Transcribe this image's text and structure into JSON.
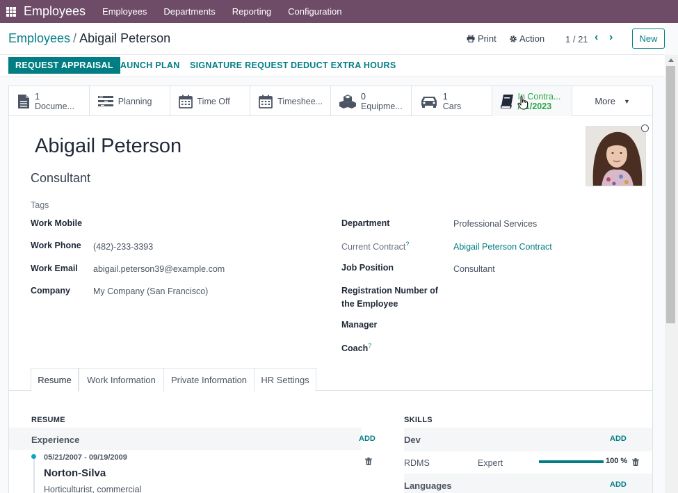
{
  "nav": {
    "app_title": "Employees",
    "items": [
      "Employees",
      "Departments",
      "Reporting",
      "Configuration"
    ]
  },
  "control": {
    "breadcrumb_parent": "Employees",
    "breadcrumb_separator": "/",
    "breadcrumb_current": "Abigail Peterson",
    "print": "Print",
    "action": "Action",
    "pager": "1 / 21",
    "new": "New"
  },
  "statusbar": {
    "buttons": [
      "REQUEST APPRAISAL",
      "LAUNCH PLAN",
      "SIGNATURE REQUEST",
      "DEDUCT EXTRA HOURS"
    ]
  },
  "smart_buttons": {
    "documents": {
      "count": "1",
      "label": "Docume..."
    },
    "planning": {
      "label": "Planning"
    },
    "time_off": {
      "label": "Time Off"
    },
    "timesheets": {
      "label": "Timeshee..."
    },
    "equipment": {
      "count": "0",
      "label": "Equipme..."
    },
    "cars": {
      "count": "1",
      "label": "Cars"
    },
    "contract": {
      "status": "In Contra...",
      "date": "/01/2023"
    },
    "more": "More"
  },
  "employee": {
    "name": "Abigail Peterson",
    "job_title": "Consultant",
    "tags_placeholder": "Tags"
  },
  "fields_left": {
    "work_mobile_label": "Work Mobile",
    "work_phone_label": "Work Phone",
    "work_phone": "(482)-233-3393",
    "work_email_label": "Work Email",
    "work_email": "abigail.peterson39@example.com",
    "company_label": "Company",
    "company": "My Company (San Francisco)"
  },
  "fields_right": {
    "department_label": "Department",
    "department": "Professional Services",
    "current_contract_label": "Current Contract",
    "help_mark": "?",
    "current_contract": "Abigail Peterson Contract",
    "job_position_label": "Job Position",
    "job_position": "Consultant",
    "registration_label_line1": "Registration Number of",
    "registration_label_line2": "the Employee",
    "manager_label": "Manager",
    "coach_label": "Coach"
  },
  "tabs": [
    "Resume",
    "Work Information",
    "Private Information",
    "HR Settings"
  ],
  "resume": {
    "heading": "RESUME",
    "experience_label": "Experience",
    "add": "ADD",
    "entry_dates": "05/21/2007 - 09/19/2009",
    "entry_company": "Norton-Silva",
    "entry_description": "Horticulturist, commercial"
  },
  "skills": {
    "heading": "SKILLS",
    "dev_label": "Dev",
    "add": "ADD",
    "skill_name": "RDMS",
    "skill_level": "Expert",
    "skill_progress": 100,
    "skill_pct": "100 %",
    "languages_label": "Languages"
  },
  "colors": {
    "nav_bg": "#6e4c68",
    "accent": "#017e84",
    "success": "#28a745"
  }
}
